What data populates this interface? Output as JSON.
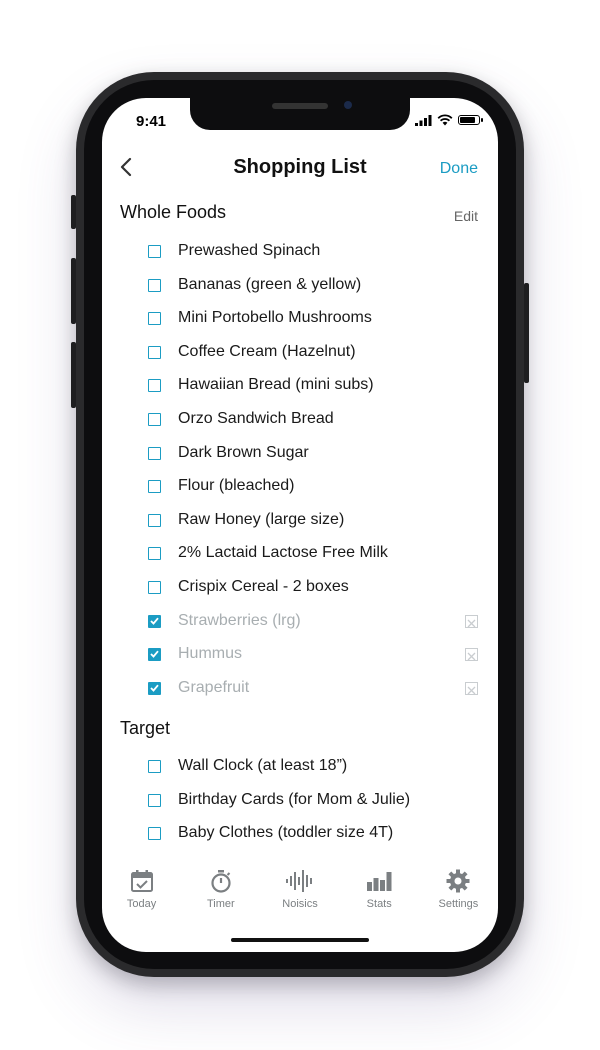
{
  "status_bar": {
    "time": "9:41"
  },
  "nav": {
    "back_icon": "chevron-left-icon",
    "title": "Shopping List",
    "done_label": "Done"
  },
  "sections": [
    {
      "name": "Whole Foods",
      "edit_label": "Edit",
      "items": [
        {
          "label": "Prewashed Spinach",
          "checked": false
        },
        {
          "label": "Bananas (green & yellow)",
          "checked": false
        },
        {
          "label": "Mini Portobello Mushrooms",
          "checked": false
        },
        {
          "label": "Coffee Cream (Hazelnut)",
          "checked": false
        },
        {
          "label": "Hawaiian Bread (mini subs)",
          "checked": false
        },
        {
          "label": "Orzo Sandwich Bread",
          "checked": false
        },
        {
          "label": "Dark Brown Sugar",
          "checked": false
        },
        {
          "label": "Flour (bleached)",
          "checked": false
        },
        {
          "label": "Raw Honey (large size)",
          "checked": false
        },
        {
          "label": "2% Lactaid Lactose Free Milk",
          "checked": false
        },
        {
          "label": "Crispix Cereal - 2 boxes",
          "checked": false
        },
        {
          "label": "Strawberries (lrg)",
          "checked": true
        },
        {
          "label": "Hummus",
          "checked": true
        },
        {
          "label": "Grapefruit",
          "checked": true
        }
      ]
    },
    {
      "name": "Target",
      "items": [
        {
          "label": "Wall Clock (at least 18”)",
          "checked": false
        },
        {
          "label": "Birthday Cards (for Mom & Julie)",
          "checked": false
        },
        {
          "label": "Baby Clothes (toddler size 4T)",
          "checked": false
        }
      ]
    }
  ],
  "tabs": [
    {
      "label": "Today",
      "icon": "calendar-check-icon"
    },
    {
      "label": "Timer",
      "icon": "stopwatch-icon"
    },
    {
      "label": "Noisics",
      "icon": "sound-wave-icon"
    },
    {
      "label": "Stats",
      "icon": "bar-chart-icon"
    },
    {
      "label": "Settings",
      "icon": "gear-icon"
    }
  ],
  "colors": {
    "accent": "#1b9cc3",
    "checked_text": "#a8aeb1",
    "tab_icon": "#7b7f82"
  }
}
